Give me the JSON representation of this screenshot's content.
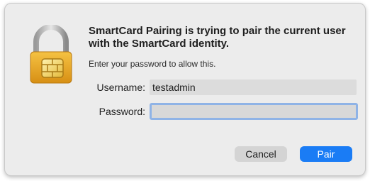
{
  "dialog": {
    "title": "SmartCard Pairing is trying to pair the current user with the SmartCard identity.",
    "subtitle": "Enter your password to allow this.",
    "icon": "smartcard-lock-icon"
  },
  "form": {
    "username_label": "Username:",
    "username_value": "testadmin",
    "password_label": "Password:",
    "password_value": ""
  },
  "buttons": {
    "cancel_label": "Cancel",
    "pair_label": "Pair"
  },
  "colors": {
    "accent": "#1a7cf5",
    "lock_gold": "#e8a825",
    "focus_ring": "#8fb3e6"
  }
}
